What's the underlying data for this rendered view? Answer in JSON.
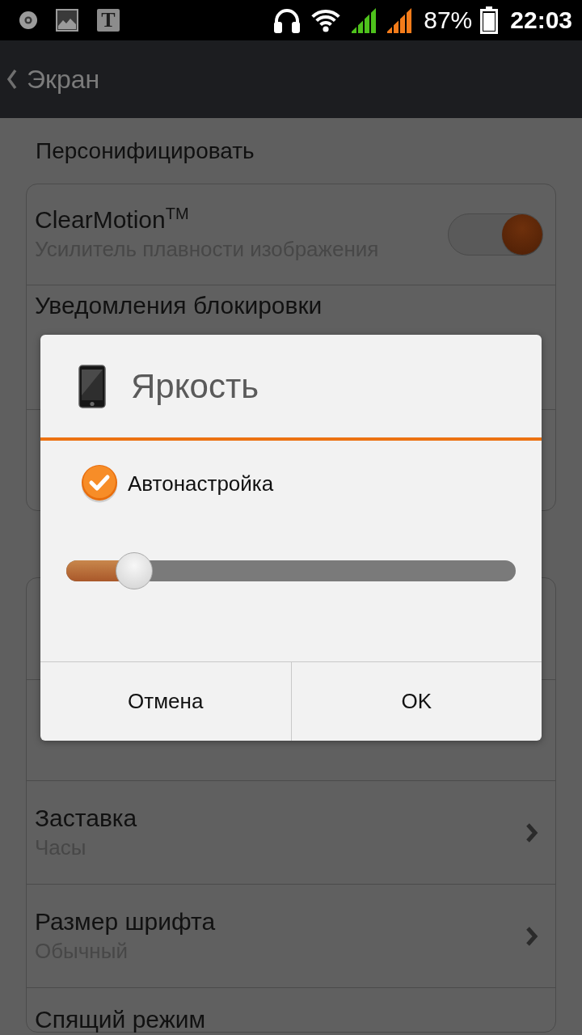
{
  "status_bar": {
    "notification_letter": "T",
    "battery": "87%",
    "time": "22:03"
  },
  "action_bar": {
    "title": "Экран"
  },
  "sections": [
    {
      "header": "Персонифицировать",
      "items": [
        {
          "kind": "toggle",
          "title": "ClearMotion$^{TM}$",
          "subtitle": "Усилитель плавности изображения",
          "on": true
        },
        {
          "kind": "tall",
          "title": "Уведомления блокировки"
        },
        {
          "kind": "blank"
        }
      ]
    },
    {
      "items": [
        {
          "kind": "blank"
        },
        {
          "kind": "blank"
        },
        {
          "kind": "link",
          "title": "Заставка",
          "subtitle": "Часы"
        },
        {
          "kind": "link",
          "title": "Размер шрифта",
          "subtitle": "Обычный"
        },
        {
          "kind": "text",
          "title": "Спящий режим"
        }
      ]
    }
  ],
  "dialog": {
    "title": "Яркость",
    "auto_brightness": {
      "label": "Автонастройка",
      "checked": true
    },
    "slider": {
      "level": 0.12
    },
    "buttons": [
      {
        "label": "Отмена"
      },
      {
        "label": "OK"
      }
    ]
  }
}
